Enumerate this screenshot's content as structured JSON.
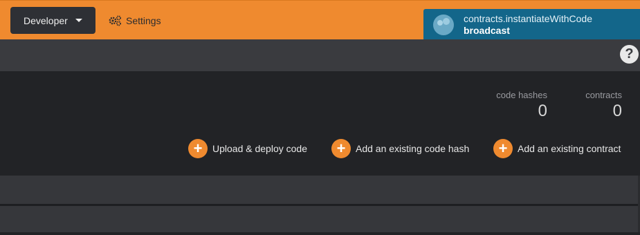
{
  "header": {
    "developer_label": "Developer",
    "settings_label": "Settings"
  },
  "toast": {
    "method": "contracts.instantiateWithCode",
    "status": "broadcast"
  },
  "help": {
    "glyph": "?"
  },
  "summary": {
    "code_hashes": {
      "label": "code hashes",
      "value": "0"
    },
    "contracts": {
      "label": "contracts",
      "value": "0"
    }
  },
  "actions": {
    "upload": "Upload & deploy code",
    "add_hash": "Add an existing code hash",
    "add_contract": "Add an existing contract",
    "plus_glyph": "+"
  },
  "colors": {
    "accent": "#ef8a2f",
    "toast_bg": "#13668a",
    "panel_bg": "#222326"
  }
}
